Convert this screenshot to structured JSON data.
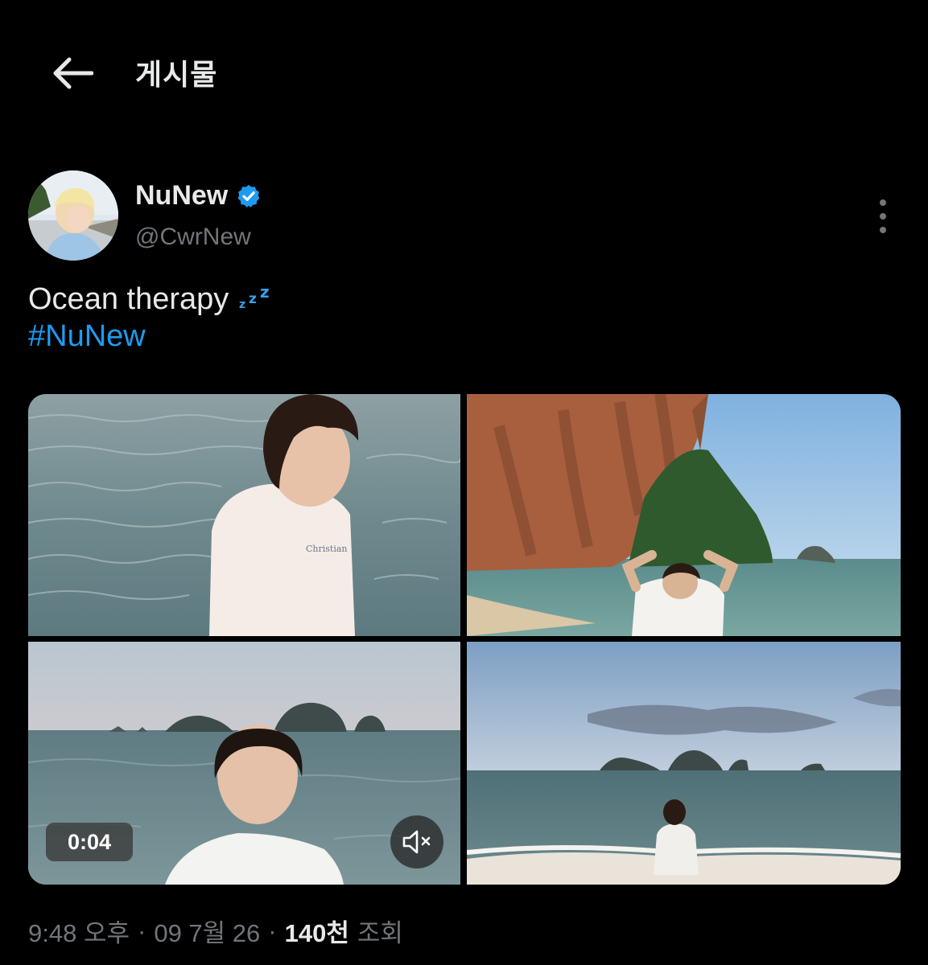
{
  "header": {
    "title": "게시물"
  },
  "author": {
    "name": "NuNew",
    "handle": "@CwrNew",
    "verified": true
  },
  "post": {
    "text": "Ocean therapy",
    "emoji": "💤",
    "hashtag": "#NuNew"
  },
  "media": {
    "video_duration": "0:04",
    "items": [
      "photo-boy-sea",
      "photo-cliff-beach",
      "video-sea-islands",
      "photo-sunset-beach"
    ]
  },
  "meta": {
    "time": "9:48 오후",
    "sep1": "·",
    "date": "09 7월 26",
    "sep2": "·",
    "views": "140천",
    "views_label": "조회"
  },
  "colors": {
    "accent": "#1d9bf0",
    "muted": "#71767b",
    "text": "#e7e9ea",
    "background": "#000000"
  },
  "icons": [
    "arrow-left-icon",
    "verified-badge-icon",
    "more-vertical-icon",
    "mute-icon"
  ]
}
